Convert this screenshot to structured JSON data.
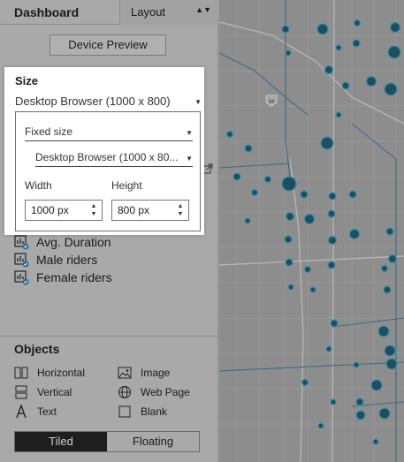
{
  "tabs": {
    "dashboard": "Dashboard",
    "layout": "Layout"
  },
  "device_preview": "Device Preview",
  "sheets": [
    {
      "label": "Avg. Duration"
    },
    {
      "label": "Male riders"
    },
    {
      "label": "Female riders"
    }
  ],
  "objects": {
    "title": "Objects",
    "items": {
      "horizontal": "Horizontal",
      "image": "Image",
      "vertical": "Vertical",
      "web_page": "Web Page",
      "text": "Text",
      "blank": "Blank"
    }
  },
  "toggle": {
    "tiled": "Tiled",
    "floating": "Floating",
    "selected": "Tiled"
  },
  "size_popup": {
    "title": "Size",
    "size_select": "Desktop Browser (1000 x 800)",
    "mode_select": "Fixed size",
    "preset_select": "Desktop Browser (1000 x 80...",
    "width_label": "Width",
    "height_label": "Height",
    "width_value": "1000 px",
    "height_value": "800 px"
  },
  "map": {
    "highway_label": "94",
    "dot_color": "#3c8fa8"
  }
}
